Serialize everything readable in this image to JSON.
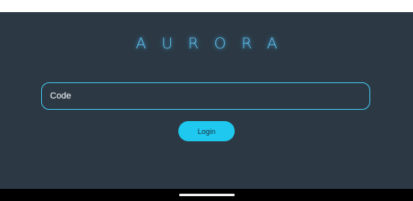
{
  "app": {
    "title": "AURORA"
  },
  "login_form": {
    "code_placeholder": "Code",
    "code_value": "",
    "login_label": "Login"
  },
  "colors": {
    "background": "#2c3944",
    "accent": "#1fc8ee",
    "logo_glow": "#5fc7f0",
    "field_border": "#44c6ee"
  }
}
